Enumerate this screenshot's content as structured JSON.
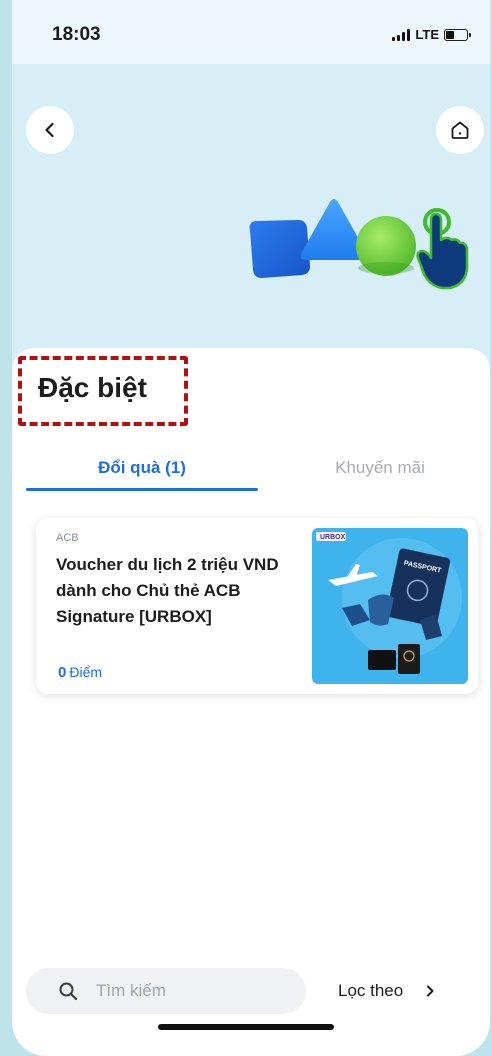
{
  "status": {
    "time": "18:03",
    "network": "LTE"
  },
  "header": {
    "back_icon": "chevron-left-icon",
    "home_icon": "home-icon"
  },
  "page": {
    "title": "Đặc biệt"
  },
  "tabs": [
    {
      "label": "Đổi quà (1)",
      "active": true
    },
    {
      "label": "Khuyến mãi",
      "active": false
    }
  ],
  "vouchers": [
    {
      "brand": "ACB",
      "title": "Voucher du lịch 2 triệu VND dành cho Chủ thẻ ACB Signature [URBOX]",
      "points_value": "0",
      "points_unit": "Điểm",
      "image_label": "PASSPORT",
      "image_logo": "URBOX"
    }
  ],
  "bottom": {
    "search_placeholder": "Tìm kiếm",
    "filter_label": "Lọc theo"
  },
  "colors": {
    "accent": "#1d6fe0",
    "annotation_frame": "#b31111",
    "header_bg": "#d7eef7",
    "thumb_bg": "#3fb4ec"
  }
}
